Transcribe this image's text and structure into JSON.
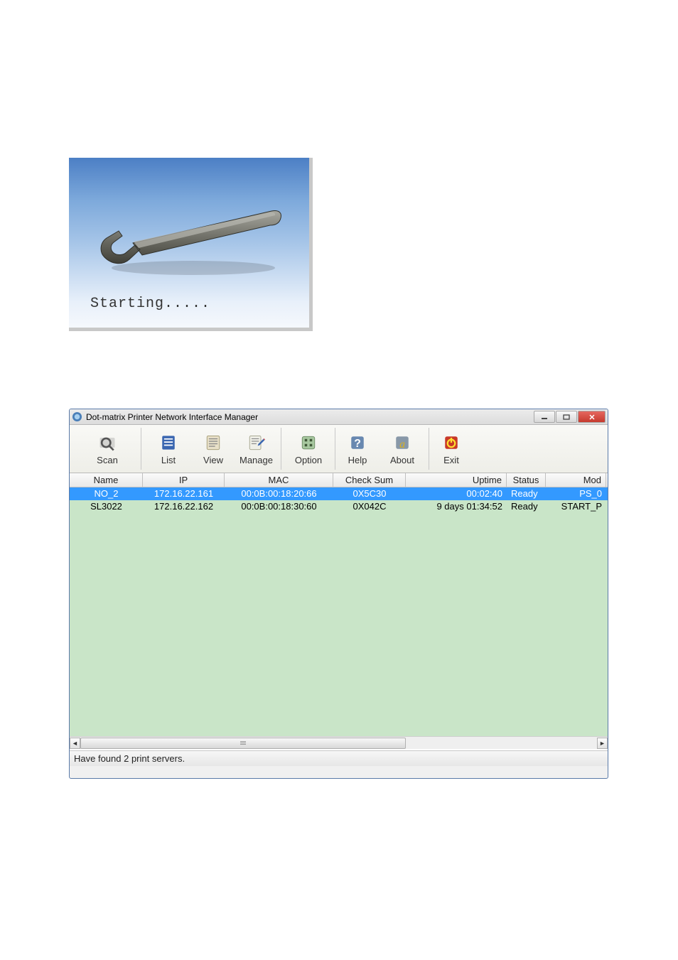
{
  "splash": {
    "text": "Starting....."
  },
  "window": {
    "title": "Dot-matrix Printer Network Interface Manager"
  },
  "toolbar": {
    "scan": "Scan",
    "list": "List",
    "view": "View",
    "manage": "Manage",
    "option": "Option",
    "help": "Help",
    "about": "About",
    "exit": "Exit"
  },
  "columns": {
    "name": "Name",
    "ip": "IP",
    "mac": "MAC",
    "check": "Check Sum",
    "uptime": "Uptime",
    "status": "Status",
    "model": "Mod"
  },
  "rows": [
    {
      "name": "NO_2",
      "ip": "172.16.22.161",
      "mac": "00:0B:00:18:20:66",
      "check": "0X5C30",
      "uptime": "00:02:40",
      "status": "Ready",
      "model": "PS_0",
      "selected": true
    },
    {
      "name": "SL3022",
      "ip": "172.16.22.162",
      "mac": "00:0B:00:18:30:60",
      "check": "0X042C",
      "uptime": "9 days 01:34:52",
      "status": "Ready",
      "model": "START_P",
      "selected": false
    }
  ],
  "status": "Have found 2 print servers."
}
